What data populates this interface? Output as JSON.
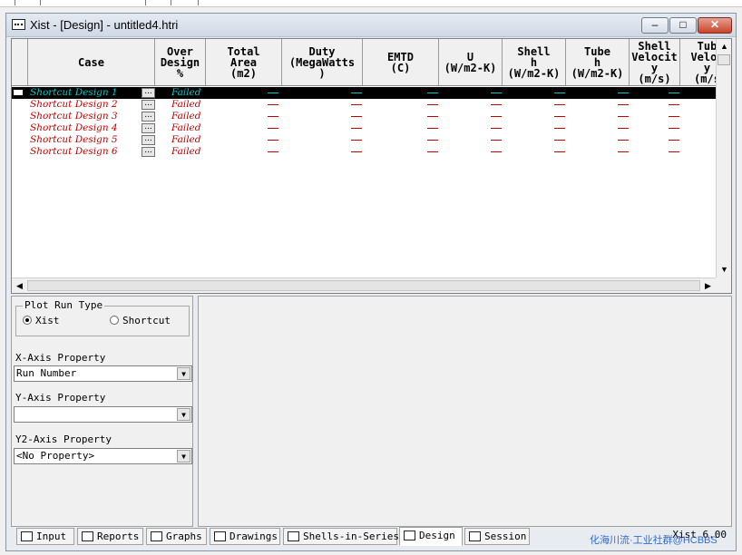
{
  "window": {
    "title": "Xist - [Design] - untitled4.htri",
    "buttons": {
      "minimize": "–",
      "maximize": "□",
      "close": "✕"
    }
  },
  "grid": {
    "columns": [
      {
        "label": "Case"
      },
      {
        "label": "Over\nDesign\n%"
      },
      {
        "label": "Total\nArea\n(m2)"
      },
      {
        "label": "Duty\n(MegaWatts\n)"
      },
      {
        "label": "EMTD\n(C)"
      },
      {
        "label": "U\n(W/m2-K)"
      },
      {
        "label": "Shell\nh\n(W/m2-K)"
      },
      {
        "label": "Tube\nh\n(W/m2-K)"
      },
      {
        "label": "Shell\nVelocit\ny\n(m/s)"
      },
      {
        "label": "Tub\nVeloc\ny\n(m/s"
      }
    ],
    "button_label": "...",
    "dash": "—",
    "rows": [
      {
        "case": "Shortcut Design 1",
        "status": "Failed",
        "selected": true
      },
      {
        "case": "Shortcut Design 2",
        "status": "Failed",
        "selected": false
      },
      {
        "case": "Shortcut Design 3",
        "status": "Failed",
        "selected": false
      },
      {
        "case": "Shortcut Design 4",
        "status": "Failed",
        "selected": false
      },
      {
        "case": "Shortcut Design 5",
        "status": "Failed",
        "selected": false
      },
      {
        "case": "Shortcut Design 6",
        "status": "Failed",
        "selected": false
      }
    ]
  },
  "plot_panel": {
    "run_type_label": "Plot Run Type",
    "run_types": [
      {
        "label": "Xist",
        "selected": true
      },
      {
        "label": "Shortcut",
        "selected": false
      }
    ],
    "x_axis_label": "X-Axis Property",
    "x_axis_value": "Run Number",
    "y_axis_label": "Y-Axis Property",
    "y_axis_value": "",
    "y2_axis_label": "Y2-Axis Property",
    "y2_axis_value": "<No Property>"
  },
  "tabs": [
    {
      "label": "Input",
      "active": false
    },
    {
      "label": "Reports",
      "active": false
    },
    {
      "label": "Graphs",
      "active": false
    },
    {
      "label": "Drawings",
      "active": false
    },
    {
      "label": "Shells-in-Series",
      "active": false
    },
    {
      "label": "Design",
      "active": true
    },
    {
      "label": "Session",
      "active": false
    }
  ],
  "version": "Xist 6.00",
  "watermark": "化海川流·工业社群@HCBBS",
  "colors": {
    "failed": "#c00000",
    "selected_text": "#00c8c8",
    "selected_bg": "#000000"
  }
}
